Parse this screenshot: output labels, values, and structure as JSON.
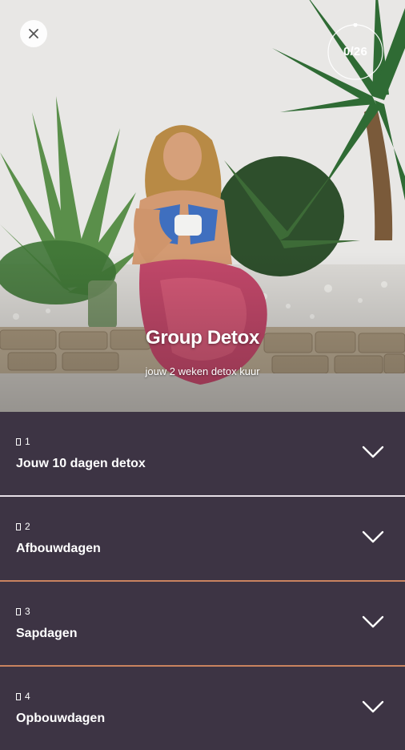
{
  "hero": {
    "title": "Group Detox",
    "subtitle": "jouw 2 weken detox kuur",
    "progress_text": "0/26",
    "progress_fraction": 0
  },
  "sections": [
    {
      "number": "1",
      "title": "Jouw 10 dagen detox"
    },
    {
      "number": "2",
      "title": "Afbouwdagen"
    },
    {
      "number": "3",
      "title": "Sapdagen"
    },
    {
      "number": "4",
      "title": "Opbouwdagen"
    }
  ],
  "colors": {
    "list_background": "#3d3444",
    "divider": "#e6dfe6",
    "divider_accent": "#c9835f"
  },
  "icons": {
    "close": "close-icon",
    "expand": "chevron-down-icon",
    "section_marker": "section-marker-icon"
  }
}
